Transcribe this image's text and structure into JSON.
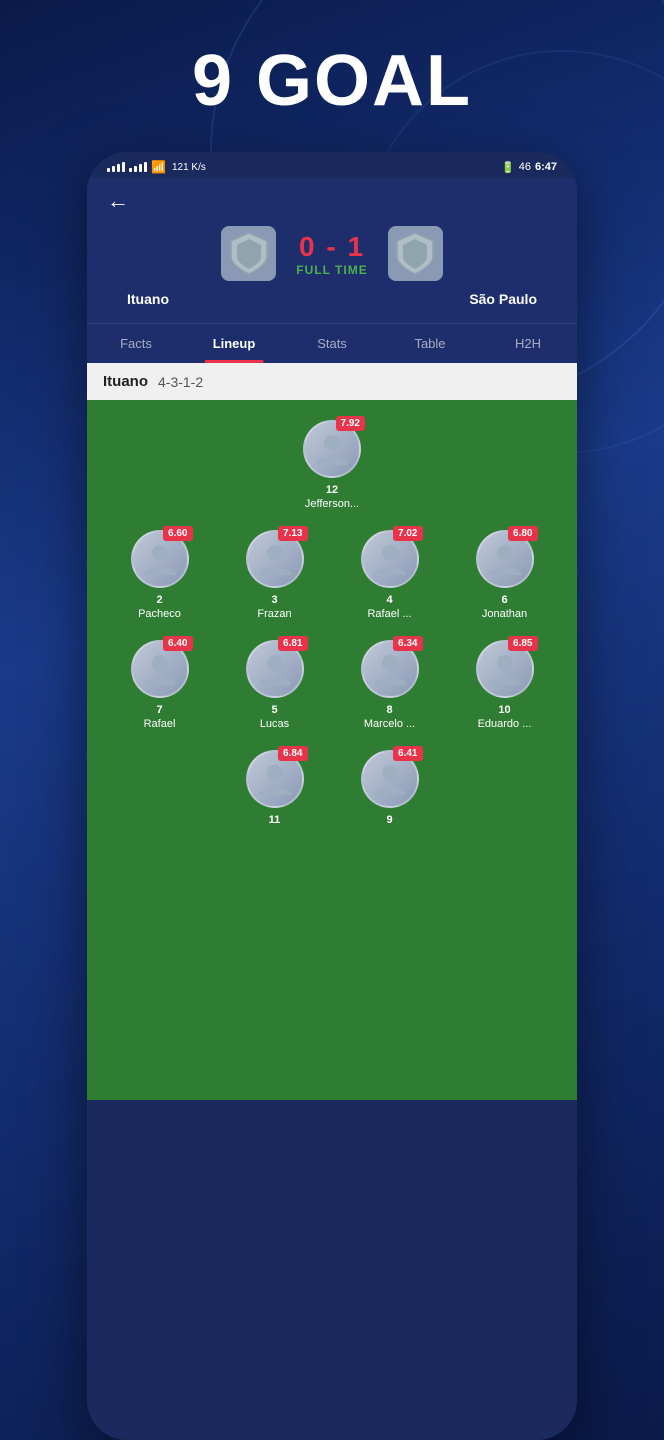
{
  "page": {
    "big_title": "9 GOAL",
    "status_bar": {
      "time": "6:47",
      "battery": "46",
      "speed": "121 K/s"
    },
    "match": {
      "score": "0 - 1",
      "status": "FULL TIME",
      "home_team": "Ituano",
      "away_team": "São Paulo"
    },
    "tabs": [
      {
        "label": "Facts",
        "active": false
      },
      {
        "label": "Lineup",
        "active": true
      },
      {
        "label": "Stats",
        "active": false
      },
      {
        "label": "Table",
        "active": false
      },
      {
        "label": "H2H",
        "active": false
      }
    ],
    "lineup": {
      "team": "Ituano",
      "formation": "4-3-1-2",
      "rows": [
        {
          "players": [
            {
              "number": "12",
              "name": "Jefferson...",
              "rating": "7.92"
            }
          ]
        },
        {
          "players": [
            {
              "number": "2",
              "name": "Pacheco",
              "rating": "6.60"
            },
            {
              "number": "3",
              "name": "Frazan",
              "rating": "7.13"
            },
            {
              "number": "4",
              "name": "Rafael ...",
              "rating": "7.02"
            },
            {
              "number": "6",
              "name": "Jonathan",
              "rating": "6.80"
            }
          ]
        },
        {
          "players": [
            {
              "number": "7",
              "name": "Rafael",
              "rating": "6.40"
            },
            {
              "number": "5",
              "name": "Lucas",
              "rating": "6.81"
            },
            {
              "number": "8",
              "name": "Marcelo ...",
              "rating": "6.34"
            },
            {
              "number": "10",
              "name": "Eduardo ...",
              "rating": "6.85"
            }
          ]
        },
        {
          "players": [
            {
              "number": "11",
              "name": "",
              "rating": "6.84"
            },
            {
              "number": "9",
              "name": "",
              "rating": "6.41"
            }
          ]
        }
      ]
    }
  }
}
